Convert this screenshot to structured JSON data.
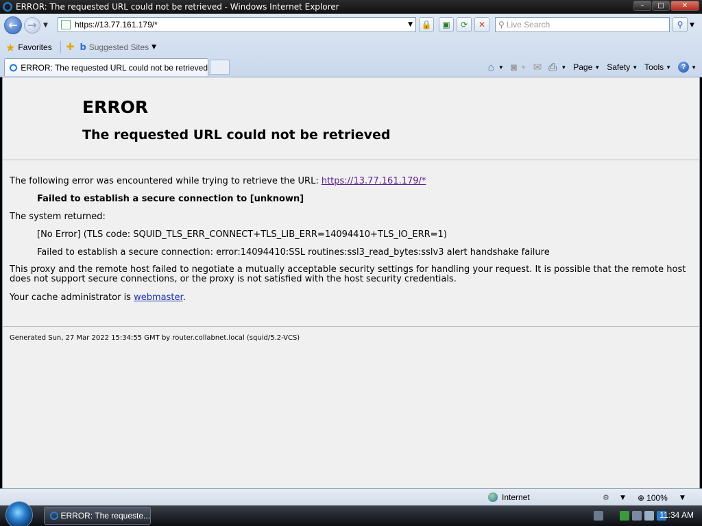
{
  "window": {
    "title": "ERROR: The requested URL could not be retrieved - Windows Internet Explorer",
    "buttons": {
      "minimize": "–",
      "maximize": "□",
      "close": "✕"
    }
  },
  "toolbar": {
    "address_url": "https://13.77.161.179/*",
    "search_placeholder": "Live Search"
  },
  "favorites_bar": {
    "favorites_label": "Favorites",
    "suggested_sites_label": "Suggested Sites"
  },
  "tabs": [
    {
      "label": "ERROR: The requested URL could not be retrieved"
    }
  ],
  "command_bar": {
    "page_label": "Page",
    "safety_label": "Safety",
    "tools_label": "Tools"
  },
  "page": {
    "heading": "ERROR",
    "subheading": "The requested URL could not be retrieved",
    "intro_text": "The following error was encountered while trying to retrieve the URL: ",
    "intro_link": "https://13.77.161.179/*",
    "failure_bold": "Failed to establish a secure connection to [unknown]",
    "system_returned": "The system returned:",
    "error_code_line": "[No Error] (TLS code: SQUID_TLS_ERR_CONNECT+TLS_LIB_ERR=14094410+TLS_IO_ERR=1)",
    "ssl_error_line": "Failed to establish a secure connection: error:14094410:SSL routines:ssl3_read_bytes:sslv3 alert handshake failure",
    "explanation": "This proxy and the remote host failed to negotiate a mutually acceptable security settings for handling your request. It is possible that the remote host does not support secure connections, or the proxy is not satisfied with the host security credentials.",
    "admin_prefix": "Your cache administrator is ",
    "admin_link": "webmaster",
    "admin_suffix": ".",
    "footer": "Generated Sun, 27 Mar 2022 15:34:55 GMT by router.collabnet.local (squid/5.2-VCS)"
  },
  "status_bar": {
    "zone": "Internet",
    "zoom": "100%"
  },
  "taskbar": {
    "task_label": "ERROR: The requeste...",
    "clock": "11:34 AM"
  }
}
